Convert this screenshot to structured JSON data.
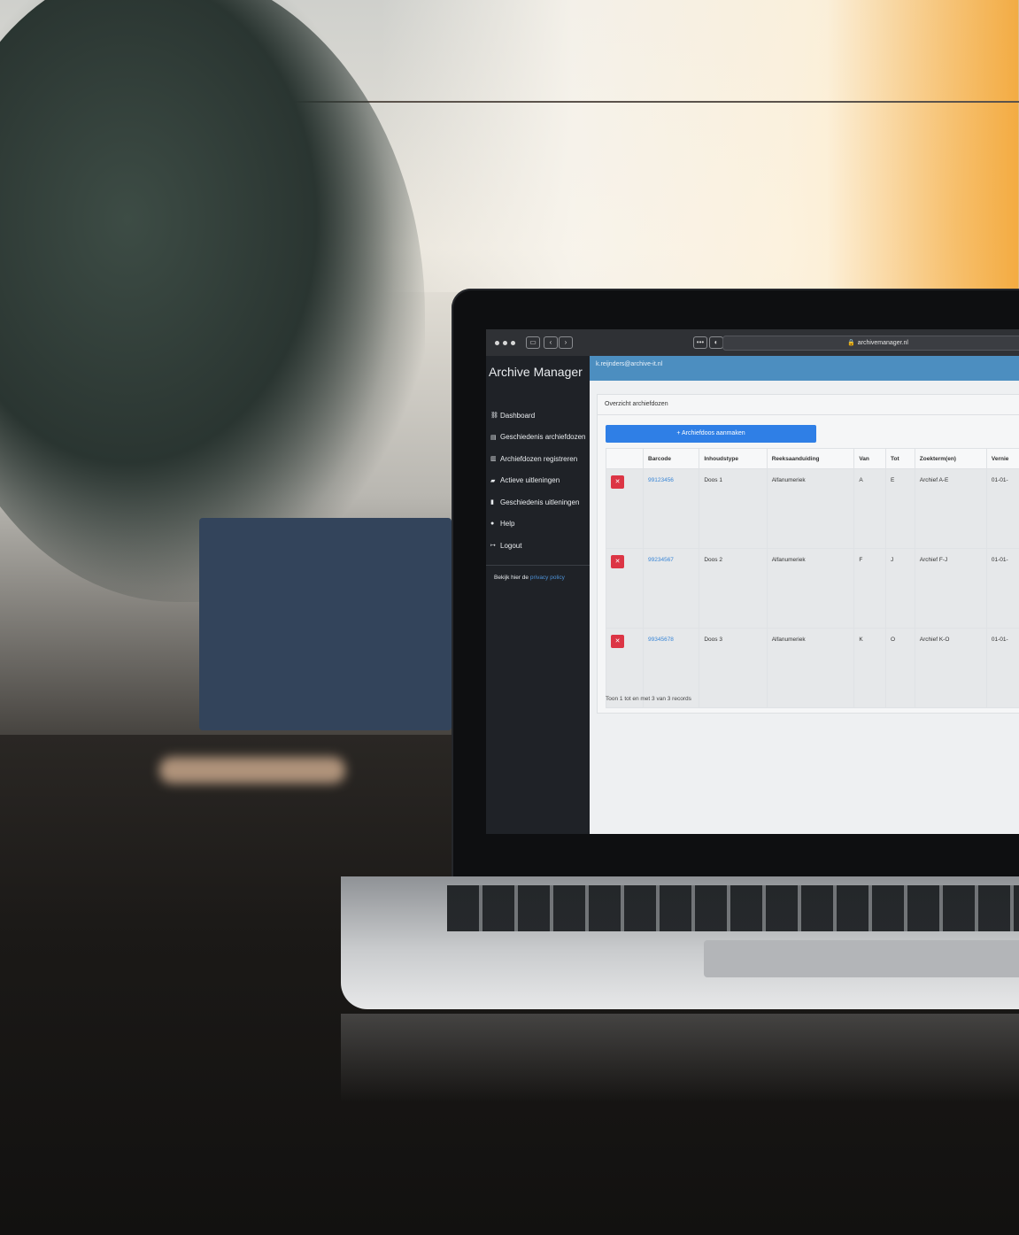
{
  "browser": {
    "url": "archivemanager.nl"
  },
  "sidebar": {
    "brand": "Archive Manager",
    "items": [
      {
        "label": "Dashboard",
        "icon": "sitemap-icon"
      },
      {
        "label": "Geschiedenis archiefdozen",
        "icon": "box-icon"
      },
      {
        "label": "Archiefdozen registreren",
        "icon": "barcode-icon"
      },
      {
        "label": "Actieve uitleningen",
        "icon": "folder-icon"
      },
      {
        "label": "Geschiedenis uitleningen",
        "icon": "book-icon"
      },
      {
        "label": "Help",
        "icon": "info-icon"
      },
      {
        "label": "Logout",
        "icon": "logout-icon"
      }
    ],
    "privacy_prefix": "Bekijk hier de",
    "privacy_link": "privacy policy"
  },
  "topbar": {
    "user": "k.reijnders@archive-it.nl"
  },
  "panel": {
    "title": "Overzicht archiefdozen",
    "add_button": "Archiefdoos aanmaken",
    "columns": [
      "",
      "Barcode",
      "Inhoudstype",
      "Reeksaanduiding",
      "Van",
      "Tot",
      "Zoekterm(en)",
      "Vernie"
    ],
    "rows": [
      {
        "barcode": "99123456",
        "inhoudstype": "Doos 1",
        "reeks": "Alfanumeriek",
        "van": "A",
        "tot": "E",
        "zoekterm": "Archief A-E",
        "vernie": "01-01-"
      },
      {
        "barcode": "99234567",
        "inhoudstype": "Doos 2",
        "reeks": "Alfanumeriek",
        "van": "F",
        "tot": "J",
        "zoekterm": "Archief F-J",
        "vernie": "01-01-"
      },
      {
        "barcode": "99345678",
        "inhoudstype": "Doos 3",
        "reeks": "Alfanumeriek",
        "van": "K",
        "tot": "O",
        "zoekterm": "Archief K-O",
        "vernie": "01-01-"
      }
    ],
    "footer": "Toon 1 tot en met 3 van 3 records"
  },
  "colors": {
    "accent": "#2f7fe6",
    "topbar": "#4c8ec0",
    "sidebar": "#1f2227",
    "danger": "#dc3545"
  }
}
